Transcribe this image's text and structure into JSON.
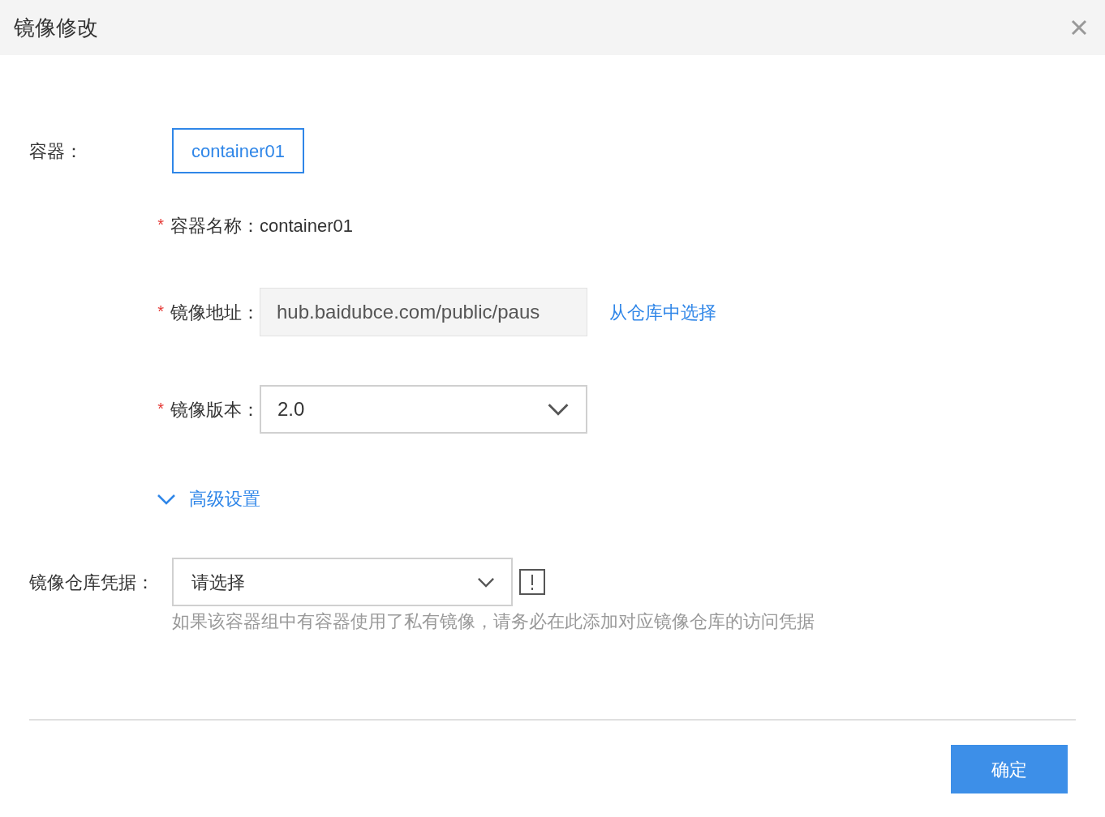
{
  "dialog": {
    "title": "镜像修改"
  },
  "container_label": "容器：",
  "container_tabs": [
    {
      "label": "container01",
      "selected": true
    }
  ],
  "fields": [
    {
      "kind": "text",
      "mark": "*",
      "label": "容器名称：",
      "value": "container01"
    },
    {
      "kind": "input",
      "mark": "*",
      "label": "镜像地址：",
      "value": "hub.baidubce.com/public/paus",
      "disabled": true,
      "link": "从仓库中选择"
    },
    {
      "kind": "select",
      "mark": "*",
      "label": "镜像版本：",
      "value": "2.0"
    }
  ],
  "advanced": {
    "label": "高级设置",
    "expanded": true
  },
  "credential": {
    "label": "镜像仓库凭据：",
    "value": "请选择",
    "hint": "如果该容器组中有容器使用了私有镜像，请务必在此添加对应镜像仓库的访问凭据"
  },
  "buttons": [
    {
      "label": "确定"
    }
  ]
}
